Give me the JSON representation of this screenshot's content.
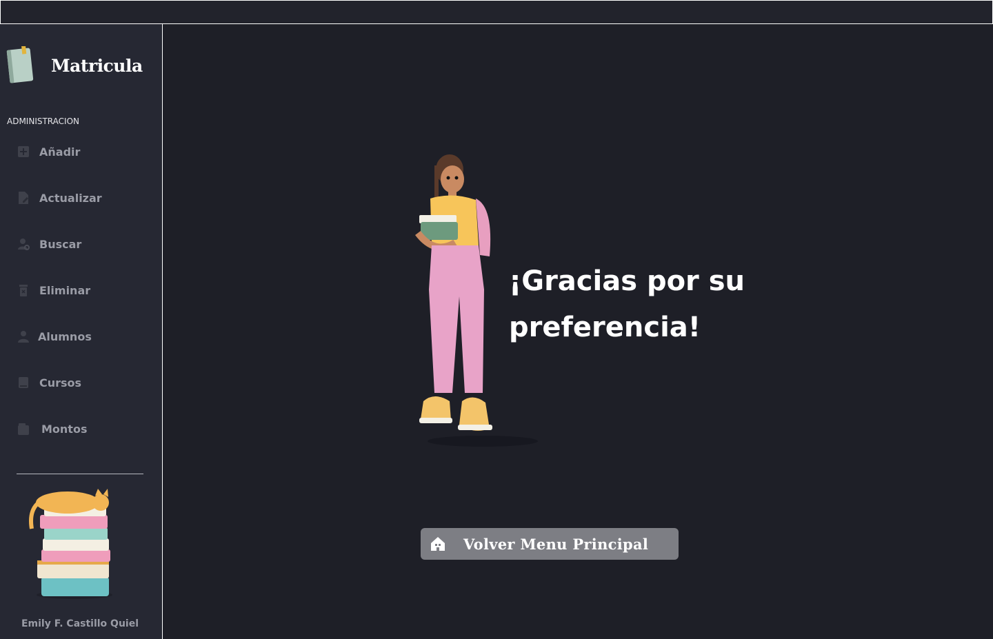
{
  "sidebar": {
    "brand": {
      "title": "Matricula",
      "icon": "book-icon"
    },
    "section_label": "ADMINISTRACION",
    "items": [
      {
        "label": "Añadir",
        "icon": "add-icon"
      },
      {
        "label": "Actualizar",
        "icon": "edit-file-icon"
      },
      {
        "label": "Buscar",
        "icon": "user-search-icon"
      },
      {
        "label": "Eliminar",
        "icon": "trash-icon"
      },
      {
        "label": "Alumnos",
        "icon": "user-icon"
      },
      {
        "label": "Cursos",
        "icon": "book-icon"
      },
      {
        "label": "Montos",
        "icon": "wallet-icon"
      }
    ],
    "footer_name": "Emily F. Castillo Quiel"
  },
  "main": {
    "thanks_line1": "¡Gracias por su",
    "thanks_line2": "preferencia!",
    "back_button": {
      "label": "Volver Menu Principal",
      "icon": "home-icon"
    }
  },
  "colors": {
    "background": "#1e1f27",
    "sidebar": "#262833",
    "nav_text": "#9a9ca6",
    "button": "#7d7e84"
  }
}
